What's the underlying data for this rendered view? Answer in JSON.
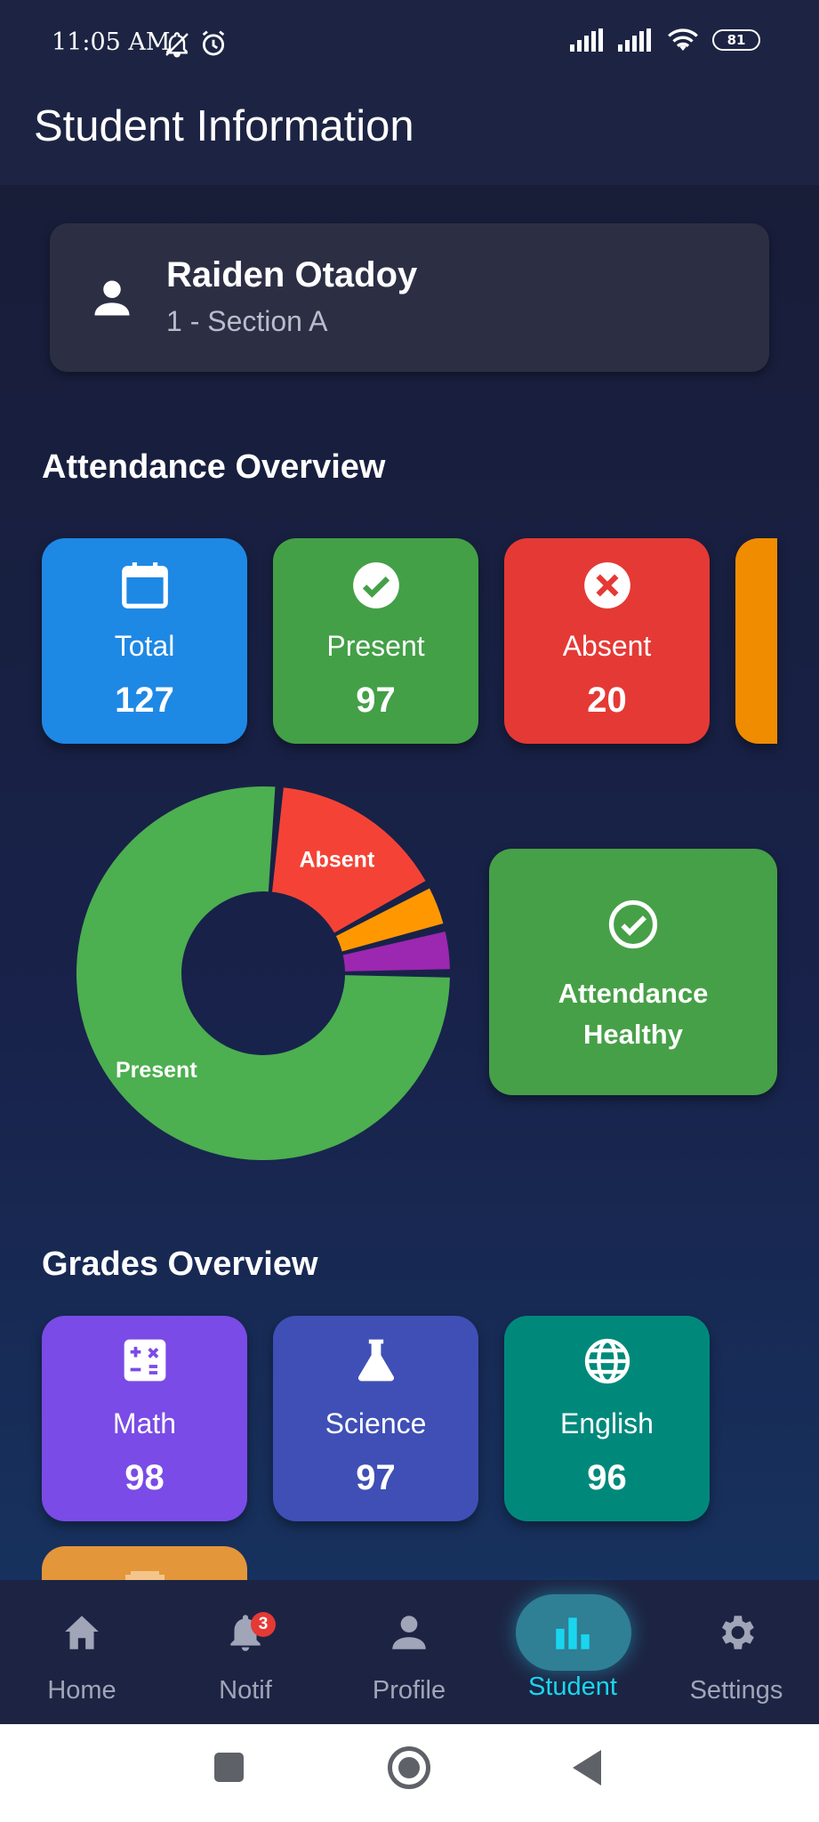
{
  "status_bar": {
    "time": "11:05 AM",
    "battery": "81",
    "icons": [
      "bell-off-icon",
      "alarm-icon",
      "signal-icon",
      "signal-icon",
      "wifi-icon",
      "battery-icon"
    ]
  },
  "app_bar": {
    "title": "Student Information"
  },
  "student": {
    "name": "Raiden Otadoy",
    "section": "1 - Section A"
  },
  "attendance": {
    "title": "Attendance Overview",
    "tiles": [
      {
        "label": "Total",
        "value": "127",
        "color": "#1e88e5",
        "icon": "calendar-icon"
      },
      {
        "label": "Present",
        "value": "97",
        "color": "#43a047",
        "icon": "check-circle-icon"
      },
      {
        "label": "Absent",
        "value": "20",
        "color": "#e53935",
        "icon": "cancel-circle-icon"
      },
      {
        "label": "",
        "value": "",
        "color": "#f08c00",
        "icon": ""
      }
    ],
    "chart_data": {
      "type": "pie",
      "donut": true,
      "categories": [
        "Present",
        "Absent",
        "",
        ""
      ],
      "values": [
        97,
        20,
        5,
        5
      ],
      "colors": [
        "#4caf50",
        "#f44336",
        "#ff9800",
        "#9c27b0"
      ],
      "slice_labels": [
        "Present",
        "Absent",
        "",
        ""
      ]
    },
    "status_card": {
      "text": "Attendance Healthy",
      "color": "#43a047",
      "icon": "check-circle-outline-icon"
    }
  },
  "grades": {
    "title": "Grades Overview",
    "tiles": [
      {
        "label": "Math",
        "value": "98",
        "color": "#7a4be6",
        "icon": "calculator-icon"
      },
      {
        "label": "Science",
        "value": "97",
        "color": "#3f4fb5",
        "icon": "flask-icon"
      },
      {
        "label": "English",
        "value": "96",
        "color": "#00897b",
        "icon": "globe-icon"
      }
    ]
  },
  "bottom_nav": {
    "items": [
      {
        "label": "Home",
        "icon": "home-icon"
      },
      {
        "label": "Notif",
        "icon": "bell-icon",
        "badge": "3"
      },
      {
        "label": "Profile",
        "icon": "person-icon"
      },
      {
        "label": "Student",
        "icon": "bar-chart-icon",
        "active": true
      },
      {
        "label": "Settings",
        "icon": "gear-icon"
      }
    ]
  },
  "system_nav": {
    "buttons": [
      "recents-button",
      "home-button",
      "back-button"
    ]
  }
}
